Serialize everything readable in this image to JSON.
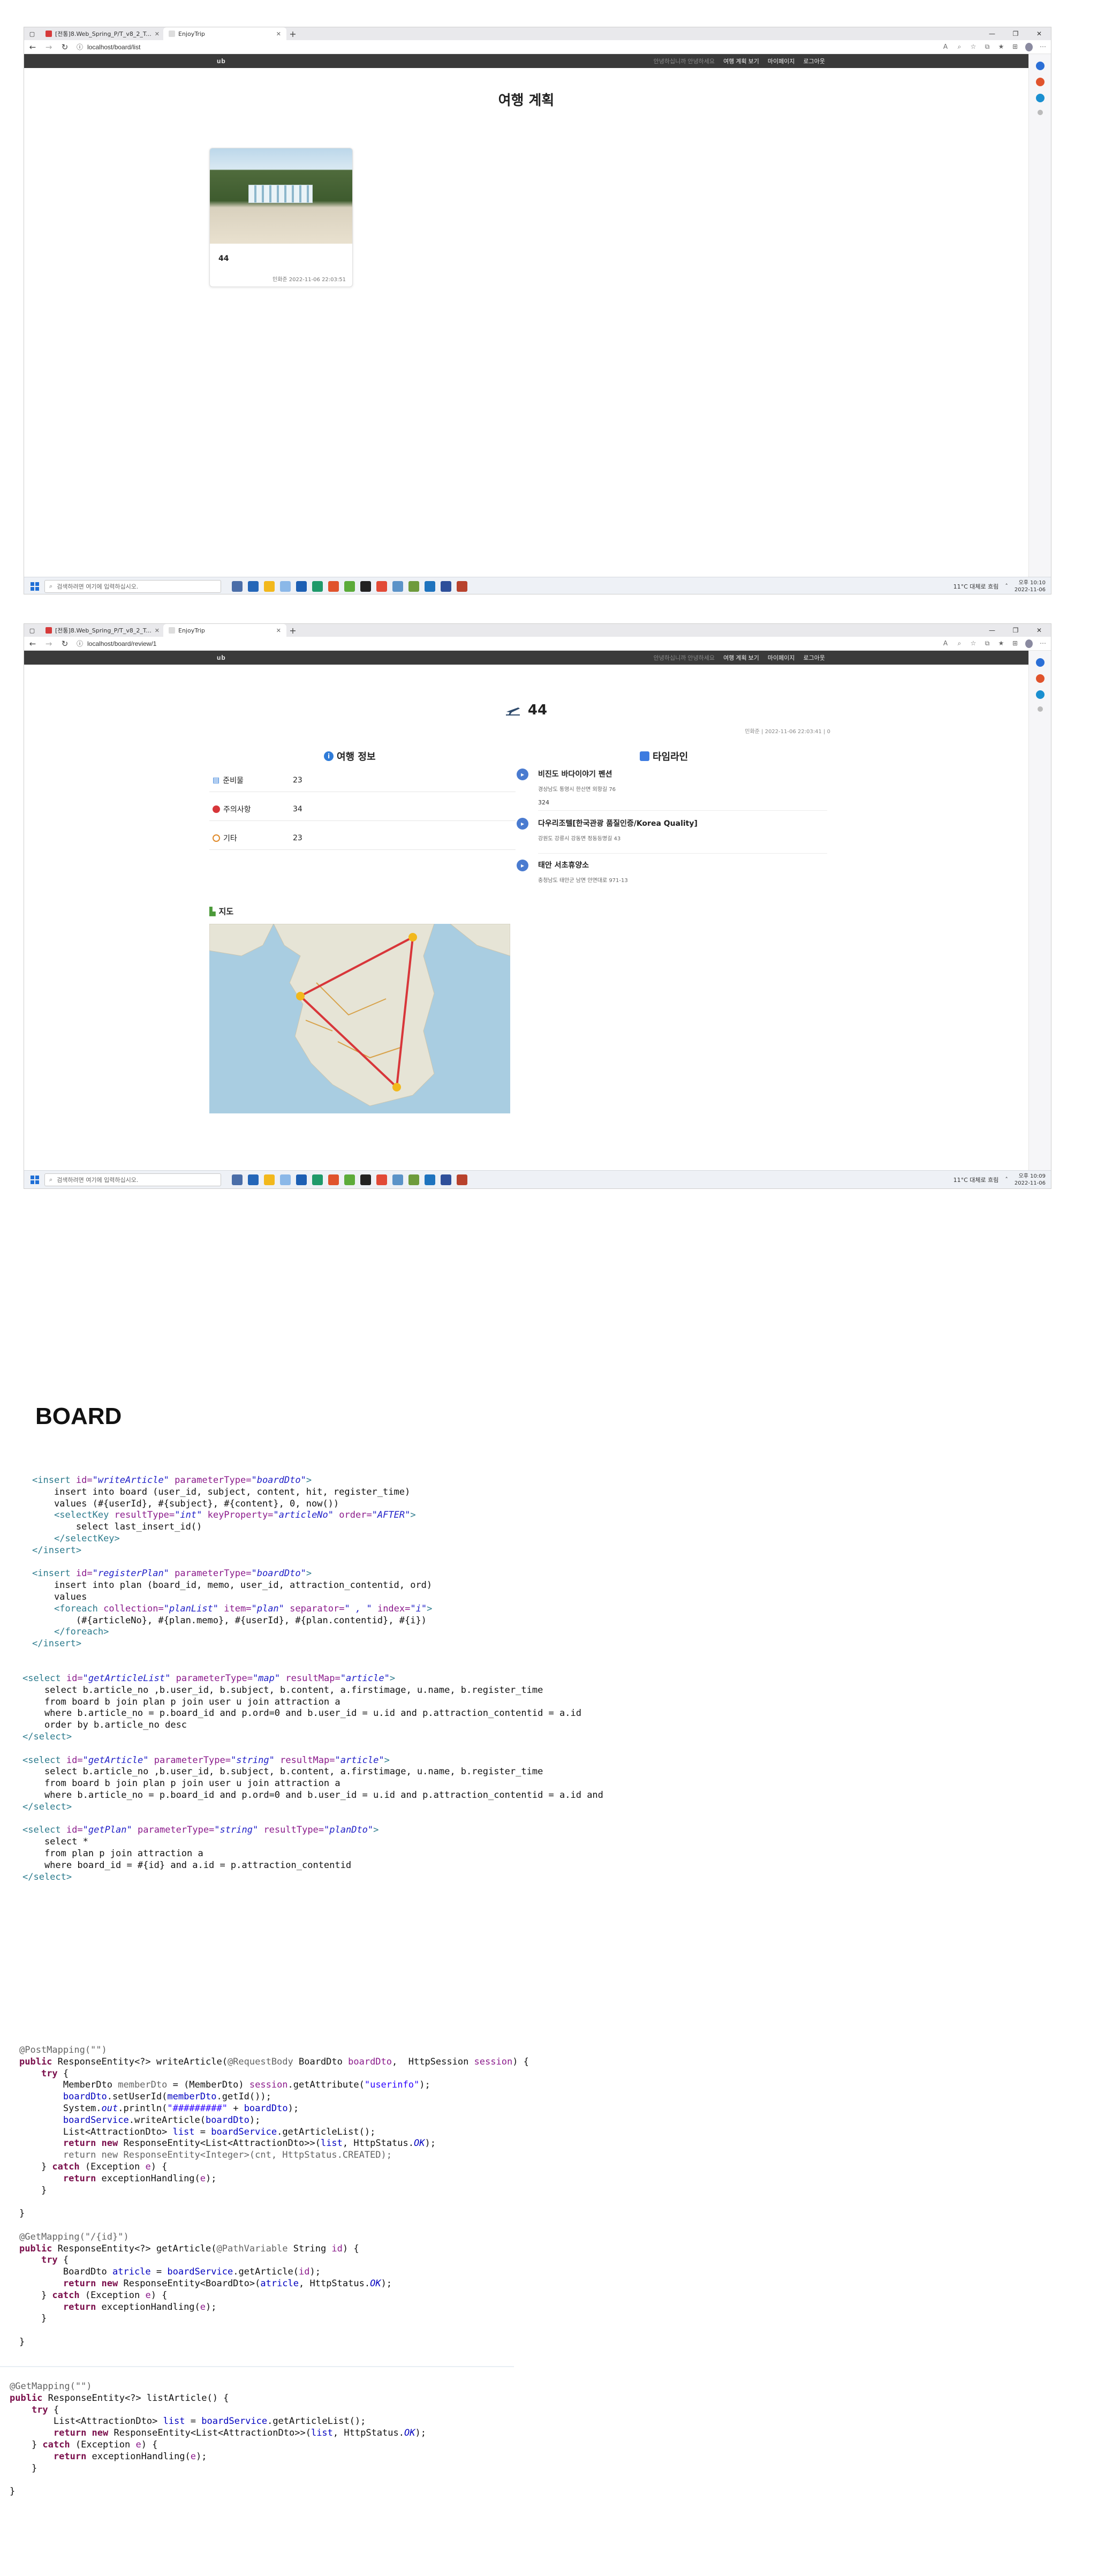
{
  "window1": {
    "tabs": [
      {
        "label": "[전통]8.Web_Spring_P/T_v8_2_T..."
      },
      {
        "label": "EnjoyTrip"
      }
    ],
    "url": "localhost/board/list",
    "window_controls": [
      "—",
      "❐",
      "✕"
    ]
  },
  "window2": {
    "tabs": [
      {
        "label": "[전통]8.Web_Spring_P/T_v8_2_T..."
      },
      {
        "label": "EnjoyTrip"
      }
    ],
    "url": "localhost/board/review/1"
  },
  "site": {
    "nav": [
      "안녕하십니까 안녕하세요",
      "여행 계획 보기",
      "마이페이지",
      "로그아웃"
    ]
  },
  "list_page": {
    "title": "여행 계획",
    "card": {
      "number": "44",
      "meta": "민화준 2022-11-06 22:03:51"
    }
  },
  "detail_page": {
    "title": "44",
    "meta": "민화준 | 2022-11-06 22:03:41 | 0",
    "info_heading": "여행 정보",
    "info": [
      {
        "label": "준비물",
        "value": "23"
      },
      {
        "label": "주의사항",
        "value": "34"
      },
      {
        "label": "기타",
        "value": "23"
      }
    ],
    "map_heading": "지도",
    "timeline_heading": "타임라인",
    "timeline": [
      {
        "title": "비진도 바다이야기 펜션",
        "address": "경상남도 통영시 한산면 외항길 76",
        "memo": "324"
      },
      {
        "title": "다우리조텔[한국관광 품질인증/Korea Quality]",
        "address": "강원도 강릉시 강동면 정동등명길 43",
        "memo": ""
      },
      {
        "title": "태안 서초휴양소",
        "address": "충청남도 태안군 남면 안면대로 971-13",
        "memo": ""
      }
    ]
  },
  "taskbar": {
    "search_placeholder": "검색하려면 여기에 입력하십시오.",
    "weather": "11°C 대체로 흐림",
    "time": "오후 10:09",
    "date": "2022-11-06",
    "time1": "오후 10:10"
  },
  "board_title": "BOARD",
  "colors": {
    "site_bar": "#3a3a3a",
    "timeline_dot": "#4a7bd0",
    "route": "#d8363a",
    "xml_tag": "#2b7a8c",
    "java_keyword": "#7a0e4b"
  }
}
